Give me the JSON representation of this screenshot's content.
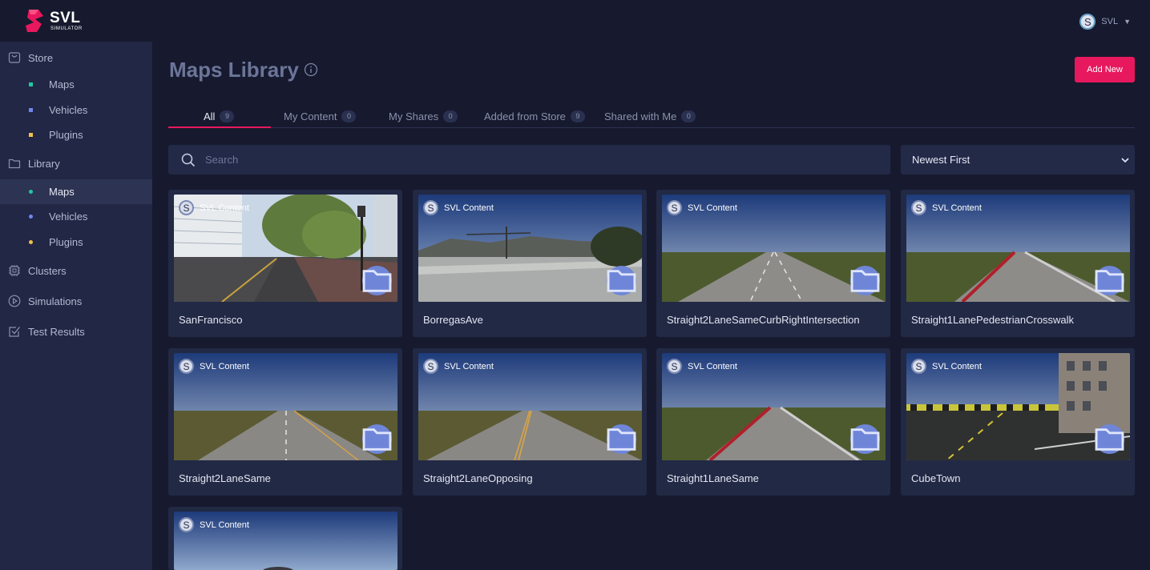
{
  "app": {
    "logo_text": "SVL",
    "logo_sub": "SIMULATOR",
    "user_initial": "S",
    "user_name": "SVL",
    "accent": "#e8185e"
  },
  "sidebar": {
    "store": {
      "label": "Store",
      "icon": "shopping-bag-icon"
    },
    "store_items": [
      {
        "label": "Maps",
        "color": "#1fc8a0"
      },
      {
        "label": "Vehicles",
        "color": "#6f86f0"
      },
      {
        "label": "Plugins",
        "color": "#f0c04a"
      }
    ],
    "library": {
      "label": "Library",
      "icon": "folder-icon"
    },
    "library_items": [
      {
        "label": "Maps",
        "color": "#1fc8a0",
        "active": true
      },
      {
        "label": "Vehicles",
        "color": "#6f86f0"
      },
      {
        "label": "Plugins",
        "color": "#f0c04a"
      }
    ],
    "clusters": {
      "label": "Clusters",
      "icon": "chip-icon"
    },
    "simulations": {
      "label": "Simulations",
      "icon": "play-circle-icon"
    },
    "test_results": {
      "label": "Test Results",
      "icon": "checkbox-icon"
    }
  },
  "page": {
    "title": "Maps Library",
    "add_button": "Add New",
    "tabs": [
      {
        "label": "All",
        "count": "9",
        "active": true
      },
      {
        "label": "My Content",
        "count": "0"
      },
      {
        "label": "My Shares",
        "count": "0"
      },
      {
        "label": "Added from Store",
        "count": "9"
      },
      {
        "label": "Shared with Me",
        "count": "0"
      }
    ],
    "search_placeholder": "Search",
    "sort_selected": "Newest First"
  },
  "maps": [
    {
      "name": "SanFrancisco",
      "owner_initial": "S",
      "owner": "SVL Content"
    },
    {
      "name": "BorregasAve",
      "owner_initial": "S",
      "owner": "SVL Content"
    },
    {
      "name": "Straight2LaneSameCurbRightIntersection",
      "owner_initial": "S",
      "owner": "SVL Content"
    },
    {
      "name": "Straight1LanePedestrianCrosswalk",
      "owner_initial": "S",
      "owner": "SVL Content"
    },
    {
      "name": "Straight2LaneSame",
      "owner_initial": "S",
      "owner": "SVL Content"
    },
    {
      "name": "Straight2LaneOpposing",
      "owner_initial": "S",
      "owner": "SVL Content"
    },
    {
      "name": "Straight1LaneSame",
      "owner_initial": "S",
      "owner": "SVL Content"
    },
    {
      "name": "CubeTown",
      "owner_initial": "S",
      "owner": "SVL Content"
    },
    {
      "name": "",
      "owner_initial": "S",
      "owner": "SVL Content"
    }
  ]
}
